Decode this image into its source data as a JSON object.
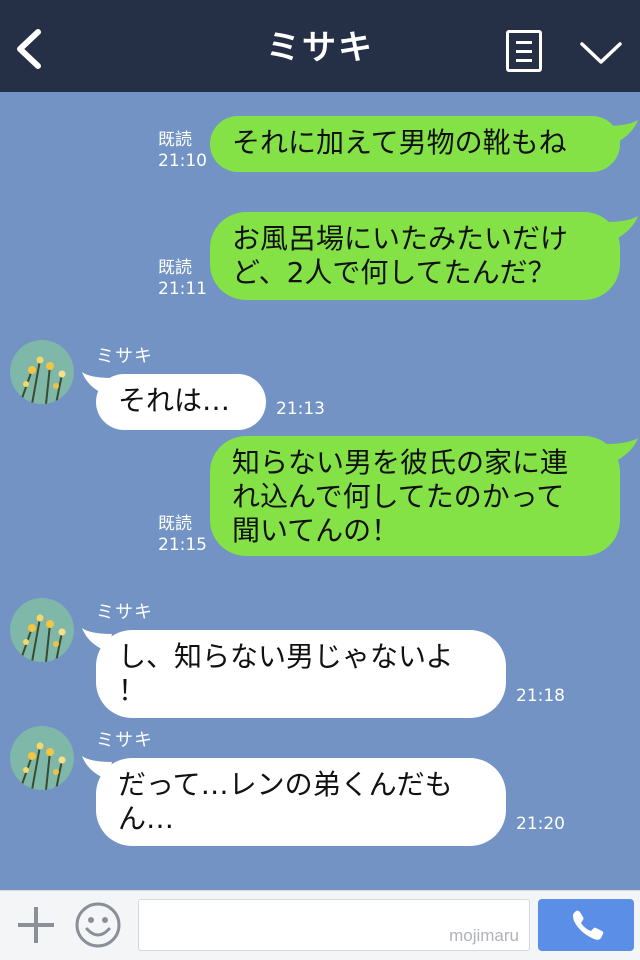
{
  "header": {
    "title": "ミサキ",
    "back_icon": "chevron-left-icon",
    "menu_icon": "note-list-icon",
    "collapse_icon": "chevron-down-icon",
    "background": "#252f45"
  },
  "chat": {
    "background": "#7293c3",
    "sent_bubble_color": "#84e247",
    "received_bubble_color": "#ffffff",
    "messages": [
      {
        "direction": "sent",
        "text": "それに加えて男物の靴もね",
        "read_label": "既読",
        "time": "21:10"
      },
      {
        "direction": "sent",
        "text": "お風呂場にいたみたいだけど、2人で何してたんだ？",
        "line1": "お風呂場にいたみたいだけ",
        "line2": "ど、2人で何してたんだ？",
        "read_label": "既読",
        "time": "21:11"
      },
      {
        "direction": "received",
        "sender": "ミサキ",
        "text": "それは…",
        "time": "21:13"
      },
      {
        "direction": "sent",
        "text": "知らない男を彼氏の家に連れ込んで何してたのかって聞いてんの！",
        "line1": "知らない男を彼氏の家に連",
        "line2": "れ込んで何してたのかって",
        "line3": "聞いてんの！",
        "read_label": "既読",
        "time": "21:15"
      },
      {
        "direction": "received",
        "sender": "ミサキ",
        "text": "し、知らない男じゃないよ！",
        "line1": "し、知らない男じゃないよ",
        "line2": "！",
        "time": "21:18"
      },
      {
        "direction": "received",
        "sender": "ミサキ",
        "text": "だって…レンの弟くんだもん…",
        "line1": "だって…レンの弟くんだも",
        "line2": "ん…",
        "time": "21:20"
      }
    ]
  },
  "footer": {
    "plus_icon": "plus-icon",
    "emoji_icon": "smiley-icon",
    "input_value": "",
    "watermark": "mojimaru",
    "call_icon": "phone-icon",
    "call_button_color": "#5b8ee6"
  }
}
